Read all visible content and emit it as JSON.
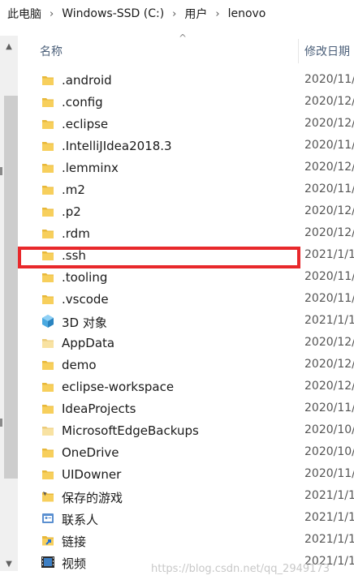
{
  "breadcrumb": {
    "items": [
      "此电脑",
      "Windows-SSD (C:)",
      "用户",
      "lenovo"
    ],
    "separator": "›"
  },
  "columns": {
    "name": "名称",
    "date": "修改日期"
  },
  "files": [
    {
      "name": ".android",
      "date": "2020/11/",
      "icon": "folder-icon"
    },
    {
      "name": ".config",
      "date": "2020/12/",
      "icon": "folder-icon"
    },
    {
      "name": ".eclipse",
      "date": "2020/12/",
      "icon": "folder-icon"
    },
    {
      "name": ".IntelliJIdea2018.3",
      "date": "2020/11/",
      "icon": "folder-icon"
    },
    {
      "name": ".lemminx",
      "date": "2020/12/",
      "icon": "folder-icon"
    },
    {
      "name": ".m2",
      "date": "2020/11/",
      "icon": "folder-icon"
    },
    {
      "name": ".p2",
      "date": "2020/12/",
      "icon": "folder-icon"
    },
    {
      "name": ".rdm",
      "date": "2020/12/",
      "icon": "folder-icon"
    },
    {
      "name": ".ssh",
      "date": "2021/1/1",
      "icon": "folder-icon"
    },
    {
      "name": ".tooling",
      "date": "2020/11/",
      "icon": "folder-icon"
    },
    {
      "name": ".vscode",
      "date": "2020/11/",
      "icon": "folder-icon"
    },
    {
      "name": "3D 对象",
      "date": "2021/1/1",
      "icon": "3d-objects-icon"
    },
    {
      "name": "AppData",
      "date": "2020/12/",
      "icon": "folder-faded-icon"
    },
    {
      "name": "demo",
      "date": "2020/12/",
      "icon": "folder-icon"
    },
    {
      "name": "eclipse-workspace",
      "date": "2020/12/",
      "icon": "folder-icon"
    },
    {
      "name": "IdeaProjects",
      "date": "2020/11/",
      "icon": "folder-icon"
    },
    {
      "name": "MicrosoftEdgeBackups",
      "date": "2020/10/",
      "icon": "folder-faded-icon"
    },
    {
      "name": "OneDrive",
      "date": "2020/10/",
      "icon": "folder-icon"
    },
    {
      "name": "UIDowner",
      "date": "2020/11/",
      "icon": "folder-icon"
    },
    {
      "name": "保存的游戏",
      "date": "2021/1/1",
      "icon": "saved-games-icon"
    },
    {
      "name": "联系人",
      "date": "2021/1/1",
      "icon": "contacts-icon"
    },
    {
      "name": "链接",
      "date": "2021/1/1",
      "icon": "links-icon"
    },
    {
      "name": "视频",
      "date": "2021/1/1",
      "icon": "videos-icon"
    }
  ],
  "highlighted_item": ".ssh",
  "watermark": "https://blog.csdn.net/qq_2949173",
  "colors": {
    "folder": "#f4c542",
    "highlight_border": "#e8282b",
    "header_text": "#4c607a"
  }
}
